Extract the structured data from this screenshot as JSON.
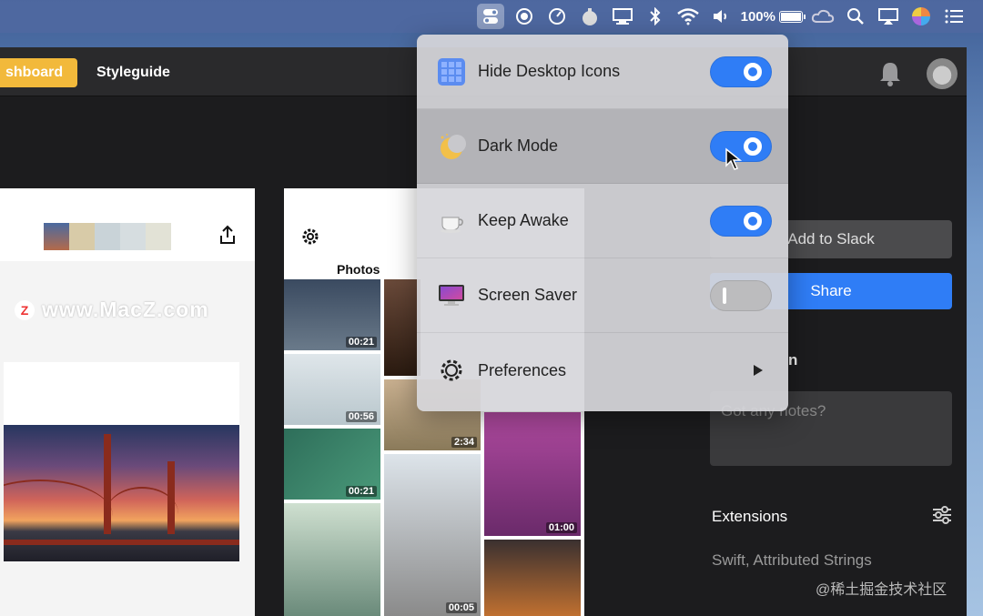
{
  "menubar": {
    "battery_text": "100%",
    "icons": [
      "one-switch-icon",
      "record-icon",
      "speedometer-icon",
      "bomb-icon",
      "display-icon",
      "bluetooth-icon",
      "wifi-icon",
      "volume-icon",
      "battery-icon",
      "creative-cloud-icon",
      "spotlight-icon",
      "airplay-icon",
      "siri-icon",
      "control-center-icon"
    ]
  },
  "app": {
    "tab_dashboard": "shboard",
    "tab_styleguide": "Styleguide"
  },
  "watermark": {
    "logo_letter": "Z",
    "text": "www.MacZ.com"
  },
  "photos": {
    "title": "Photos",
    "items": [
      {
        "duration": "00:21"
      },
      {
        "duration": ""
      },
      {
        "duration": "00:56"
      },
      {
        "duration": "2:34"
      },
      {
        "duration": "00:21"
      },
      {
        "duration": ""
      },
      {
        "duration": "01:00"
      },
      {
        "duration": ""
      },
      {
        "duration": "00:05"
      },
      {
        "duration": ""
      }
    ]
  },
  "right_panel": {
    "add_to_slack": "Add to Slack",
    "share": "Share",
    "partial_heading": "n",
    "notes_placeholder": "Got any notes?",
    "extensions_title": "Extensions",
    "extensions_value": "Swift, Attributed Strings"
  },
  "footer_watermark": "@稀土掘金技术社区",
  "dropdown": {
    "items": [
      {
        "label": "Hide Desktop Icons",
        "toggle": true,
        "icon": "desktop-grid-icon"
      },
      {
        "label": "Dark Mode",
        "toggle": true,
        "icon": "moon-icon"
      },
      {
        "label": "Keep Awake",
        "toggle": true,
        "icon": "coffee-cup-icon"
      },
      {
        "label": "Screen Saver",
        "toggle": false,
        "icon": "screen-saver-icon"
      },
      {
        "label": "Preferences",
        "icon": "gear-icon"
      }
    ]
  },
  "colors": {
    "accent_blue": "#2f7df6",
    "dashboard_tab": "#f2b93b",
    "app_background": "#1c1c1e"
  }
}
